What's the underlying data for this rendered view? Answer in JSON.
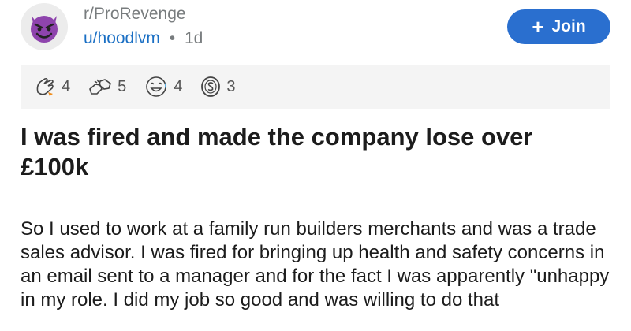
{
  "post": {
    "subreddit": "r/ProRevenge",
    "username": "u/hoodlvm",
    "separator": "•",
    "time": "1d",
    "join_label": "Join",
    "join_icon": "plus-icon",
    "avatar_icon": "devil-face-icon",
    "awards": [
      {
        "icon": "hand-wave-award-icon",
        "count": "4"
      },
      {
        "icon": "fist-bump-award-icon",
        "count": "5"
      },
      {
        "icon": "laughing-face-award-icon",
        "count": "4"
      },
      {
        "icon": "silver-coin-award-icon",
        "count": "3"
      }
    ],
    "title": "I was fired and made the company lose over £100k",
    "body": "So I used to work at a family run builders merchants and was a trade sales advisor. I was fired for bringing up health and safety concerns in an email sent to a manager and for the fact I was apparently \"unhappy in my role. I did my job so good and was willing to do that"
  },
  "colors": {
    "accent": "#2a6fcf",
    "link": "#1a6fc4",
    "muted": "#787c7e",
    "avatar_purple": "#8e44ad"
  }
}
